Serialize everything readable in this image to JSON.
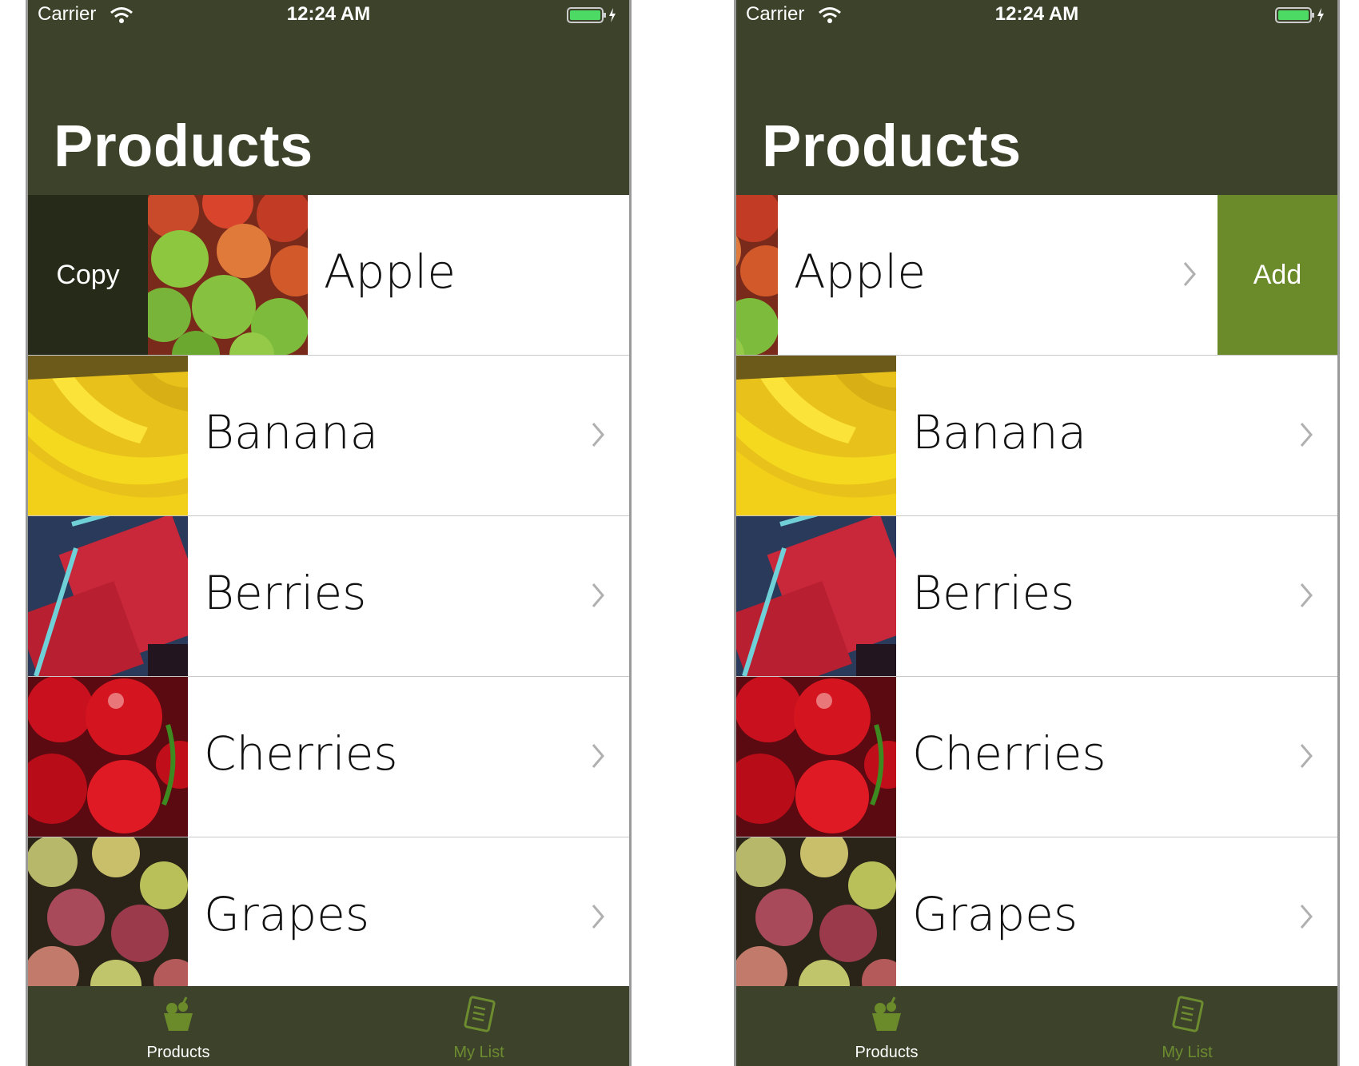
{
  "status": {
    "carrier": "Carrier",
    "time": "12:24 AM"
  },
  "title": "Products",
  "actions": {
    "copy": "Copy",
    "add": "Add"
  },
  "products": [
    {
      "name": "Apple",
      "image": "apple"
    },
    {
      "name": "Banana",
      "image": "banana"
    },
    {
      "name": "Berries",
      "image": "berries"
    },
    {
      "name": "Cherries",
      "image": "cherries"
    },
    {
      "name": "Grapes",
      "image": "grapes"
    }
  ],
  "tabs": [
    {
      "label": "Products",
      "icon": "fruit-basket-icon",
      "active": true
    },
    {
      "label": "My List",
      "icon": "list-icon",
      "active": false
    }
  ],
  "colors": {
    "nav": "#3d432b",
    "copy_action": "#262a18",
    "add_action": "#6b8a2a",
    "tab_active": "#ffffff",
    "tab_inactive": "#6d8b2f"
  }
}
